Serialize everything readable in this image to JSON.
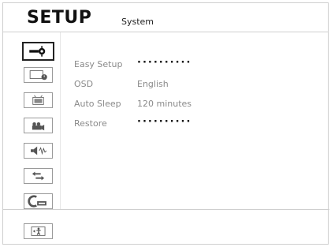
{
  "header": {
    "title": "SETUP",
    "subtitle": "System"
  },
  "sidebar": {
    "items": [
      {
        "icon": "system-icon",
        "selected": true
      },
      {
        "icon": "timer-icon",
        "selected": false
      },
      {
        "icon": "tv-icon",
        "selected": false
      },
      {
        "icon": "video-icon",
        "selected": false
      },
      {
        "icon": "audio-icon",
        "selected": false
      },
      {
        "icon": "connection-icon",
        "selected": false
      },
      {
        "icon": "dvd-icon",
        "selected": false
      },
      {
        "icon": "exit-icon",
        "selected": false
      }
    ]
  },
  "menu": {
    "rows": [
      {
        "label": "Easy Setup",
        "value": "··········",
        "type": "action"
      },
      {
        "label": "OSD",
        "value": "English",
        "type": "value"
      },
      {
        "label": "Auto Sleep",
        "value": "120 minutes",
        "type": "value"
      },
      {
        "label": "Restore",
        "value": "··········",
        "type": "action"
      }
    ]
  },
  "colors": {
    "label": "#8a8a8a",
    "border": "#cfcfcf",
    "selected_border": "#222222"
  }
}
